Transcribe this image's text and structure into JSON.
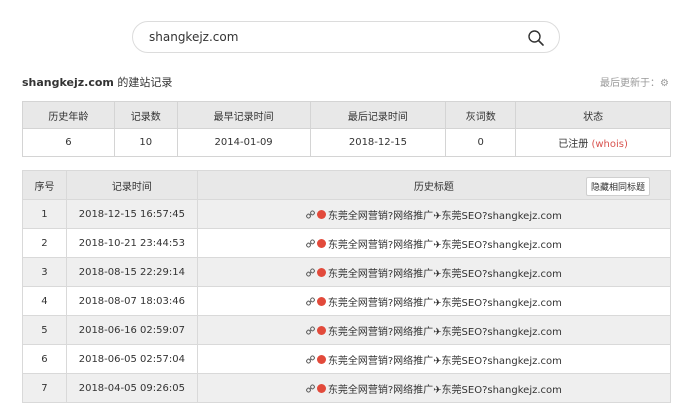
{
  "search": {
    "value": "shangkejz.com"
  },
  "header": {
    "domain": "shangkejz.com",
    "suffix": " 的建站记录",
    "last_updated": "最后更新于：",
    "gear_glyph": "⚙"
  },
  "summary": {
    "headers": [
      "历史年龄",
      "记录数",
      "最早记录时间",
      "最后记录时间",
      "灰词数",
      "状态"
    ],
    "values": {
      "age": "6",
      "count": "10",
      "earliest": "2014-01-09",
      "latest": "2018-12-15",
      "gray": "0",
      "status": "已注册",
      "whois_open": " (",
      "whois": "whois",
      "whois_close": ")"
    }
  },
  "history": {
    "headers": {
      "no": "序号",
      "time": "记录时间",
      "title": "历史标题",
      "hide_button": "隐藏相同标题"
    },
    "rows": [
      {
        "no": "1",
        "time": "2018-12-15 16:57:45",
        "title": "东莞全网营销?网络推广✈东莞SEO?shangkejz.com"
      },
      {
        "no": "2",
        "time": "2018-10-21 23:44:53",
        "title": "东莞全网营销?网络推广✈东莞SEO?shangkejz.com"
      },
      {
        "no": "3",
        "time": "2018-08-15 22:29:14",
        "title": "东莞全网营销?网络推广✈东莞SEO?shangkejz.com"
      },
      {
        "no": "4",
        "time": "2018-08-07 18:03:46",
        "title": "东莞全网营销?网络推广✈东莞SEO?shangkejz.com"
      },
      {
        "no": "5",
        "time": "2018-06-16 02:59:07",
        "title": "东莞全网营销?网络推广✈东莞SEO?shangkejz.com"
      },
      {
        "no": "6",
        "time": "2018-06-05 02:57:04",
        "title": "东莞全网营销?网络推广✈东莞SEO?shangkejz.com"
      },
      {
        "no": "7",
        "time": "2018-04-05 09:26:05",
        "title": "东莞全网营销?网络推广✈东莞SEO?shangkejz.com"
      }
    ]
  }
}
